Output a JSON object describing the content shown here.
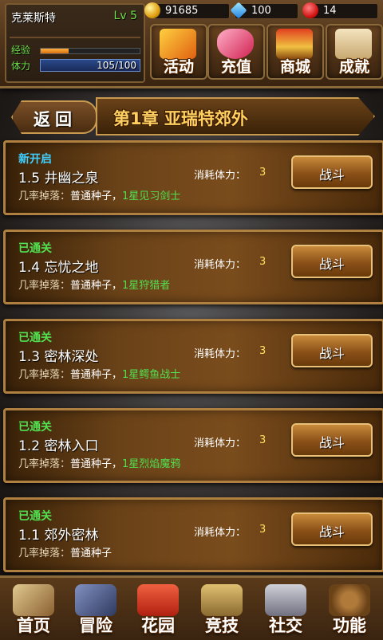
{
  "player": {
    "name": "克莱斯特",
    "level": "Lv 5",
    "exp_label": "经验",
    "exp_fraction": 0.28,
    "stamina_label": "体力",
    "stamina_value": "105/100"
  },
  "currency": {
    "gold": "91685",
    "gems": "100",
    "hearts": "14"
  },
  "top_nav": [
    {
      "label": "活动",
      "icon": "gift-icon"
    },
    {
      "label": "充值",
      "icon": "gem-icon"
    },
    {
      "label": "商城",
      "icon": "treasure-chest-icon"
    },
    {
      "label": "成就",
      "icon": "scroll-icon"
    }
  ],
  "chapter": {
    "back_label": "返回",
    "title": "第1章 亚瑞特郊外"
  },
  "stages": [
    {
      "status": "新开启",
      "status_color": "#40d0ff",
      "name": "1.5 井幽之泉",
      "drop_label": "几率掉落：",
      "drop_normal": "普通种子，",
      "drop_rare": "1星见习剑士",
      "cost_label": "消耗体力：",
      "cost": "3",
      "button": "战斗"
    },
    {
      "status": "已通关",
      "status_color": "#50e050",
      "name": "1.4 忘忧之地",
      "drop_label": "几率掉落：",
      "drop_normal": "普通种子，",
      "drop_rare": "1星狩猎者",
      "cost_label": "消耗体力：",
      "cost": "3",
      "button": "战斗"
    },
    {
      "status": "已通关",
      "status_color": "#50e050",
      "name": "1.3 密林深处",
      "drop_label": "几率掉落：",
      "drop_normal": "普通种子，",
      "drop_rare": "1星鳄鱼战士",
      "cost_label": "消耗体力：",
      "cost": "3",
      "button": "战斗"
    },
    {
      "status": "已通关",
      "status_color": "#50e050",
      "name": "1.2 密林入口",
      "drop_label": "几率掉落：",
      "drop_normal": "普通种子，",
      "drop_rare": "1星烈焰魔鸦",
      "cost_label": "消耗体力：",
      "cost": "3",
      "button": "战斗"
    },
    {
      "status": "已通关",
      "status_color": "#50e050",
      "name": "1.1 郊外密林",
      "drop_label": "几率掉落：",
      "drop_normal": "普通种子",
      "drop_rare": "",
      "cost_label": "消耗体力：",
      "cost": "3",
      "button": "战斗"
    }
  ],
  "bottom_nav": [
    {
      "label": "首页",
      "icon": "book-icon"
    },
    {
      "label": "冒险",
      "icon": "sword-helmet-icon"
    },
    {
      "label": "花园",
      "icon": "flower-icon"
    },
    {
      "label": "竞技",
      "icon": "arena-icon"
    },
    {
      "label": "社交",
      "icon": "handshake-icon"
    },
    {
      "label": "功能",
      "icon": "ship-wheel-icon"
    }
  ]
}
